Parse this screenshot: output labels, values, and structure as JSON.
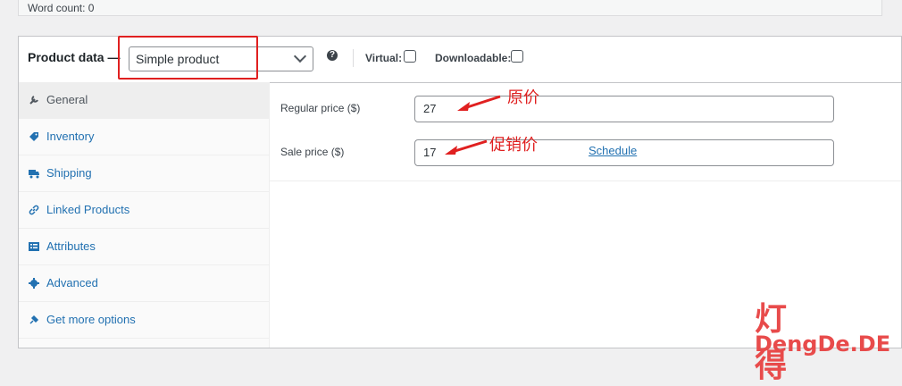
{
  "word_count": "Word count: 0",
  "product_data": {
    "title": "Product data —",
    "type_value": "Simple product",
    "help_icon": "help-icon",
    "virtual_label": "Virtual:",
    "downloadable_label": "Downloadable:"
  },
  "tabs": [
    {
      "label": "General",
      "icon": "wrench-icon"
    },
    {
      "label": "Inventory",
      "icon": "tag-icon"
    },
    {
      "label": "Shipping",
      "icon": "truck-icon"
    },
    {
      "label": "Linked Products",
      "icon": "link-icon"
    },
    {
      "label": "Attributes",
      "icon": "list-icon"
    },
    {
      "label": "Advanced",
      "icon": "gear-icon"
    },
    {
      "label": "Get more options",
      "icon": "plugin-icon"
    }
  ],
  "general": {
    "regular_price_label": "Regular price ($)",
    "regular_price_value": "27",
    "sale_price_label": "Sale price ($)",
    "sale_price_value": "17",
    "schedule_link": "Schedule"
  },
  "annotations": {
    "original_price": "原价",
    "sale_price": "促销价",
    "highlight_color": "#e02020"
  },
  "watermark": {
    "chars": "灯得",
    "domain": "DengDe.DE"
  }
}
